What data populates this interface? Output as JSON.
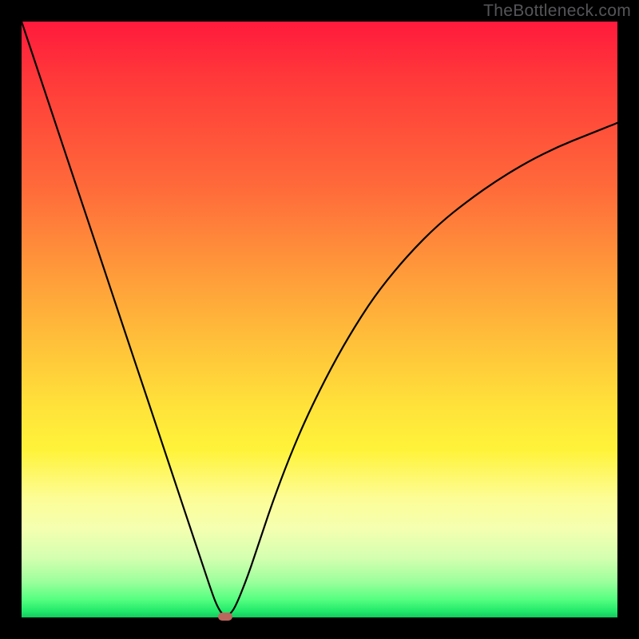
{
  "watermark": "TheBottleneck.com",
  "colors": {
    "frame": "#000000",
    "gradient_top": "#ff1a3c",
    "gradient_mid": "#ffe33a",
    "gradient_bottom": "#15c85e",
    "curve": "#000000",
    "marker": "#bb675e"
  },
  "chart_data": {
    "type": "line",
    "title": "",
    "xlabel": "",
    "ylabel": "",
    "xlim": [
      0,
      100
    ],
    "ylim": [
      0,
      100
    ],
    "x": [
      0,
      2,
      4,
      6,
      8,
      10,
      12,
      14,
      16,
      18,
      20,
      22,
      24,
      26,
      28,
      30,
      32,
      33,
      34,
      35,
      36,
      38,
      40,
      42,
      45,
      48,
      52,
      56,
      60,
      65,
      70,
      75,
      80,
      85,
      90,
      95,
      100
    ],
    "values": [
      100,
      94,
      88,
      82,
      76,
      70,
      64,
      58,
      52,
      46,
      40,
      34,
      28,
      22,
      16,
      10,
      4,
      1.5,
      0.2,
      0.5,
      2,
      7,
      13,
      19,
      27,
      34,
      42,
      49,
      55,
      61,
      66,
      70,
      73.5,
      76.5,
      79,
      81,
      83
    ],
    "marker": {
      "x": 34.2,
      "y": 0.2
    },
    "grid": false,
    "legend": false
  }
}
